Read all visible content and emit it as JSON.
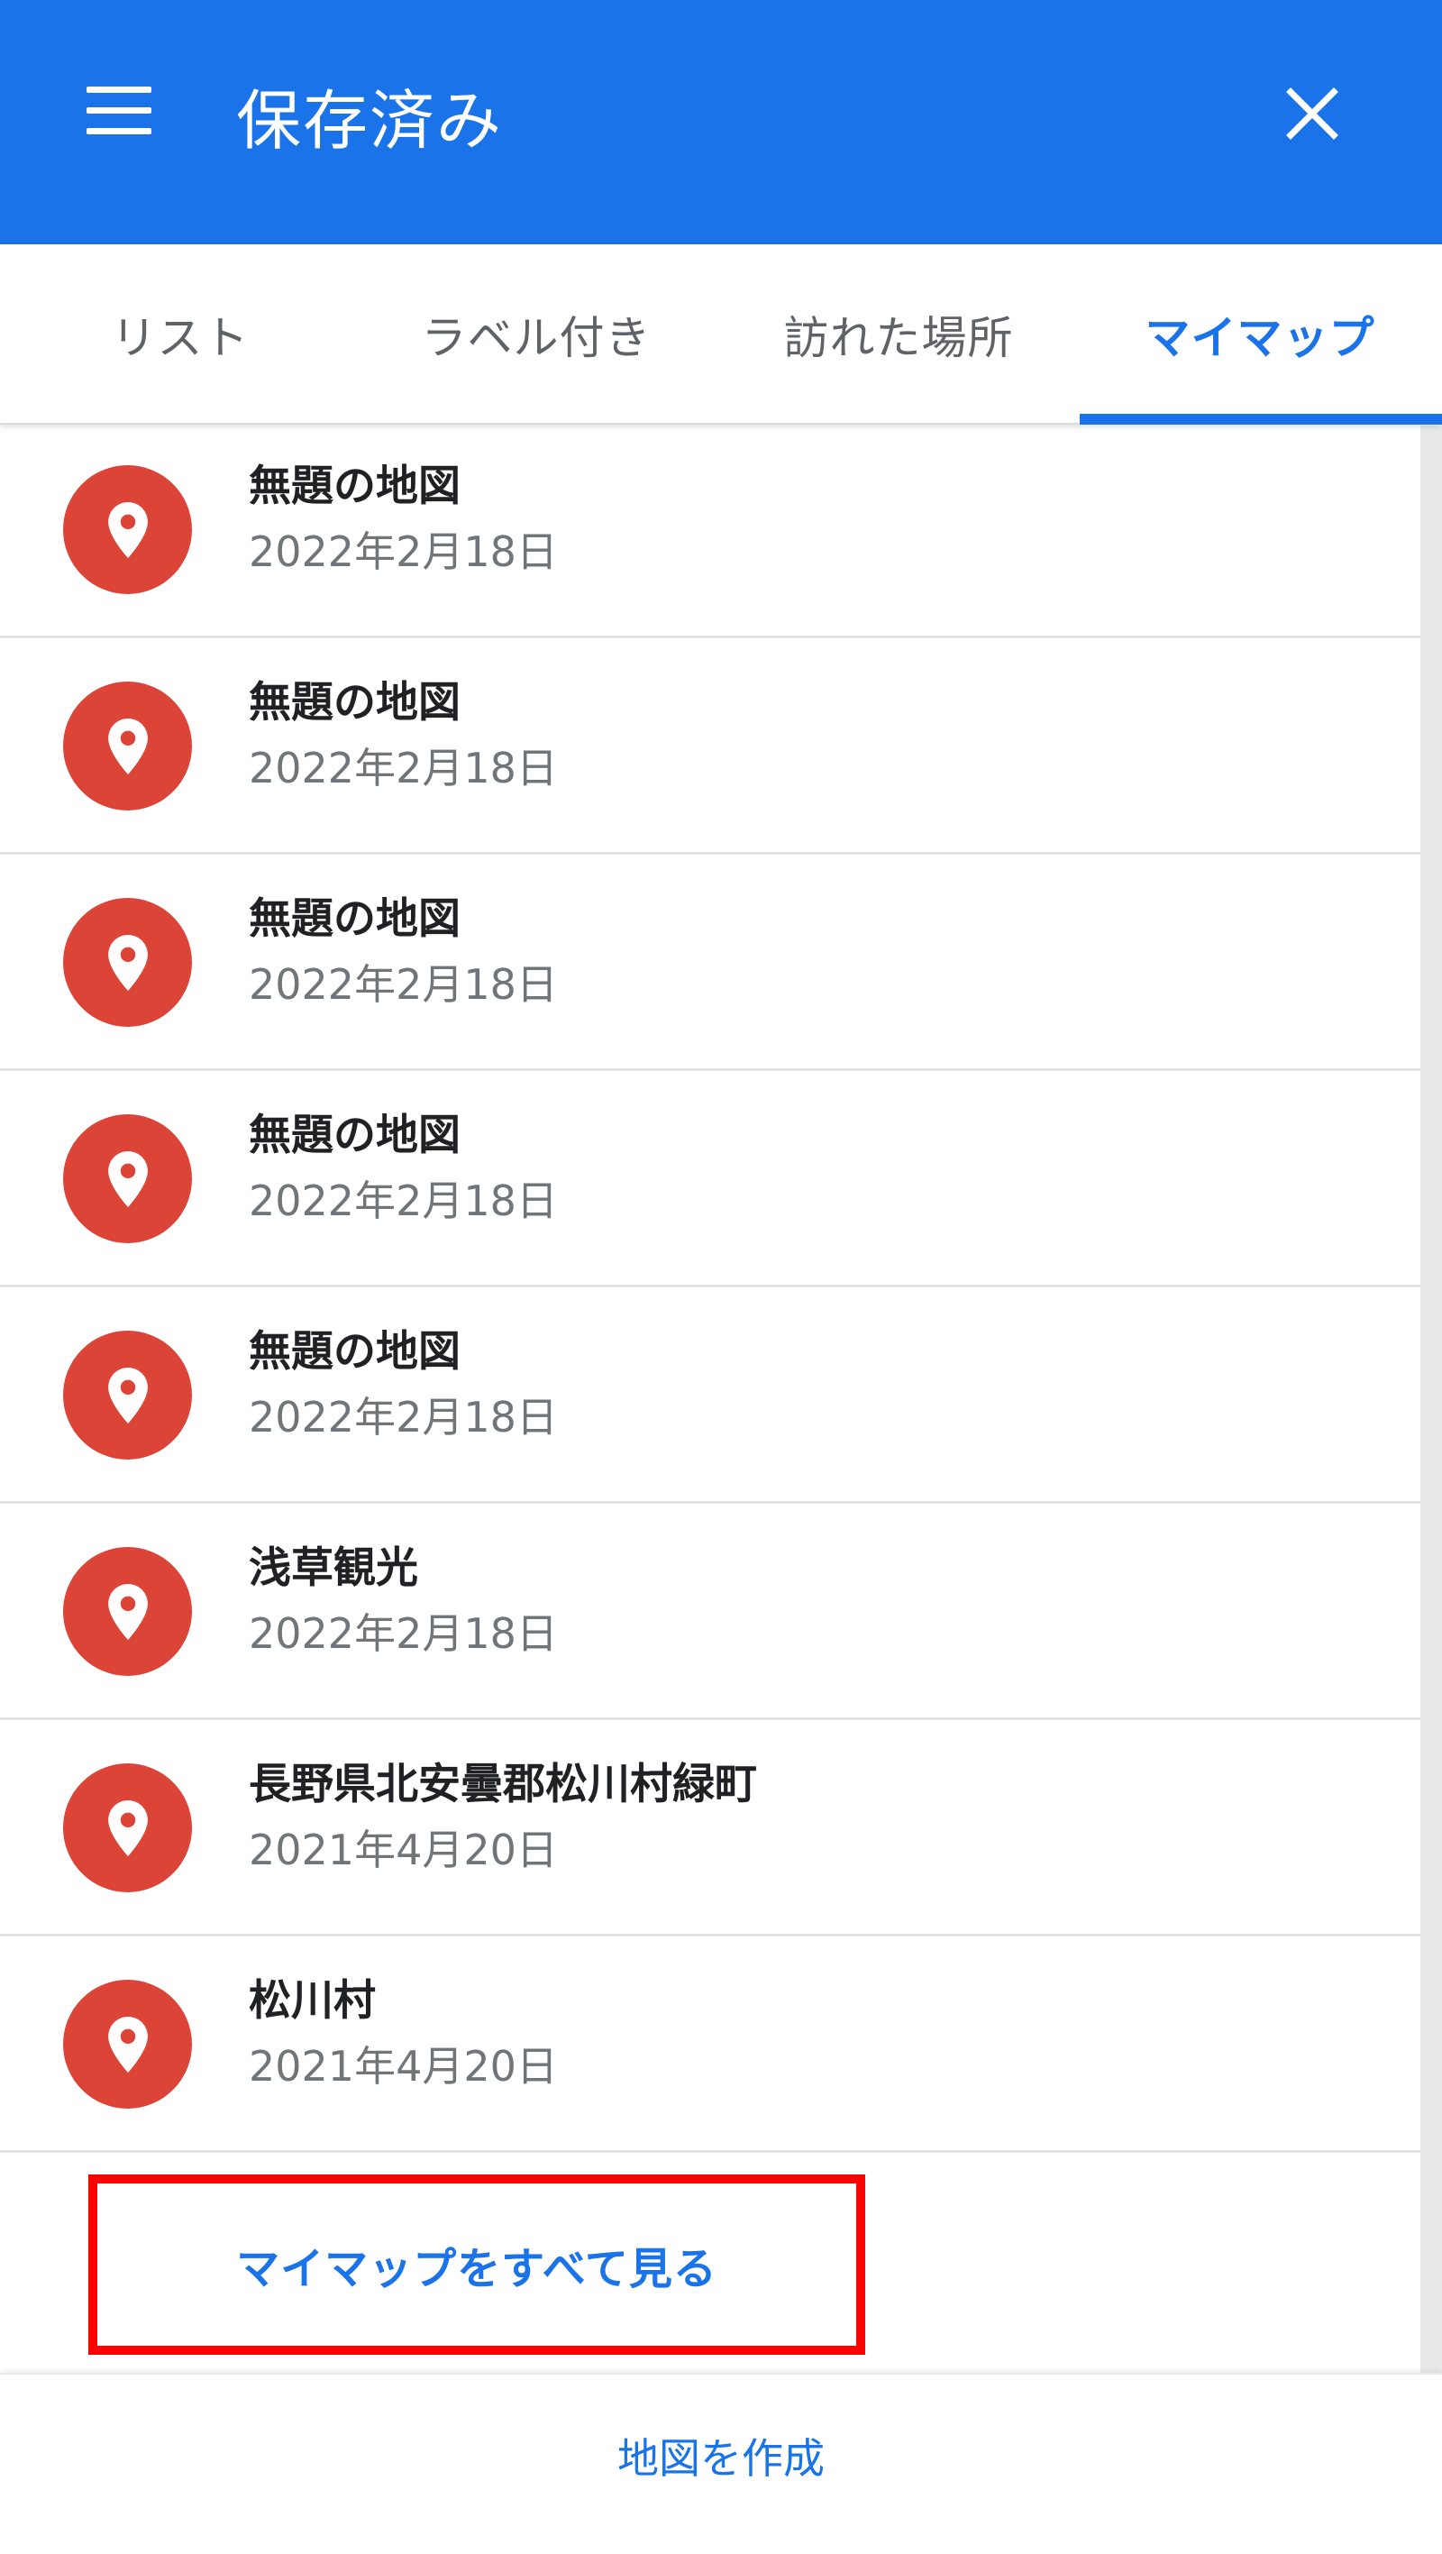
{
  "appbar": {
    "title": "保存済み",
    "menu_icon": "menu-icon",
    "close_icon": "close-icon"
  },
  "tabs": [
    {
      "label": "リスト"
    },
    {
      "label": "ラベル付き"
    },
    {
      "label": "訪れた場所"
    },
    {
      "label": "マイマップ"
    }
  ],
  "active_tab": "マイマップ",
  "maps": [
    {
      "title": "無題の地図",
      "date": "2022年2月18日"
    },
    {
      "title": "無題の地図",
      "date": "2022年2月18日"
    },
    {
      "title": "無題の地図",
      "date": "2022年2月18日"
    },
    {
      "title": "無題の地図",
      "date": "2022年2月18日"
    },
    {
      "title": "無題の地図",
      "date": "2022年2月18日"
    },
    {
      "title": "浅草観光",
      "date": "2022年2月18日"
    },
    {
      "title": "長野県北安曇郡松川村緑町",
      "date": "2021年4月20日"
    },
    {
      "title": "松川村",
      "date": "2021年4月20日"
    }
  ],
  "see_all_label": "マイマップをすべて見る",
  "create_map_label": "地図を作成",
  "colors": {
    "primary": "#1a73e8",
    "pin": "#db4437",
    "highlight_border": "#ff0000"
  }
}
